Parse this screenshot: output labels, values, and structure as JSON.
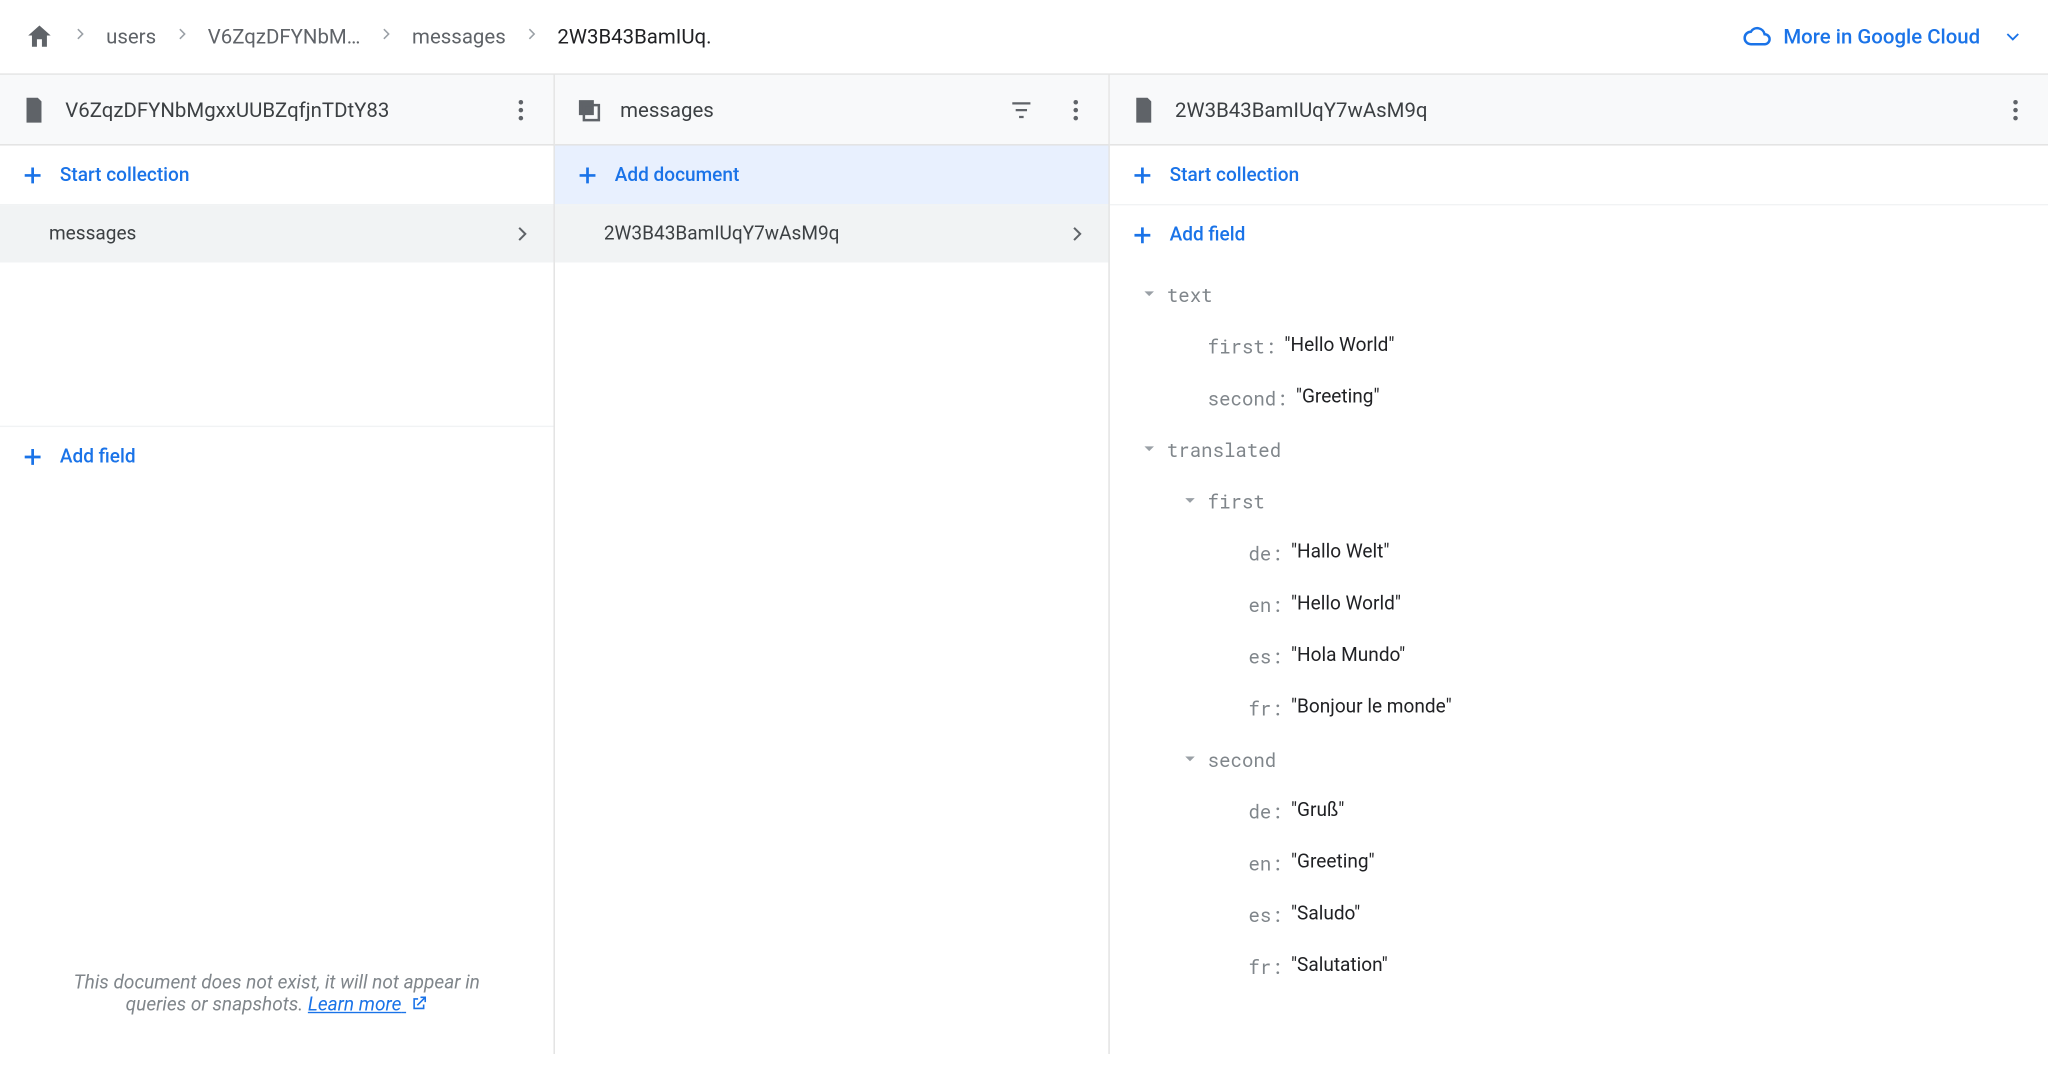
{
  "breadcrumb": {
    "segments": [
      "users",
      "V6ZqzDFYNbM…",
      "messages",
      "2W3B43BamIUq."
    ],
    "cloud_link": "More in Google Cloud"
  },
  "panel1": {
    "title": "V6ZqzDFYNbMgxxUUBZqfjnTDtY83",
    "start_collection": "Start collection",
    "list": [
      "messages"
    ],
    "add_field": "Add field",
    "warn_text": "This document does not exist, it will not appear in queries or snapshots. ",
    "warn_link": "Learn more"
  },
  "panel2": {
    "title": "messages",
    "add_document": "Add document",
    "list": [
      "2W3B43BamIUqY7wAsM9q"
    ]
  },
  "panel3": {
    "title": "2W3B43BamIUqY7wAsM9q",
    "start_collection": "Start collection",
    "add_field": "Add field",
    "fields": {
      "text": {
        "first": "Hello World",
        "second": "Greeting"
      },
      "translated": {
        "first": {
          "de": "Hallo Welt",
          "en": "Hello World",
          "es": "Hola Mundo",
          "fr": "Bonjour le monde"
        },
        "second": {
          "de": "Gruß",
          "en": "Greeting",
          "es": "Saludo",
          "fr": "Salutation"
        }
      }
    }
  }
}
